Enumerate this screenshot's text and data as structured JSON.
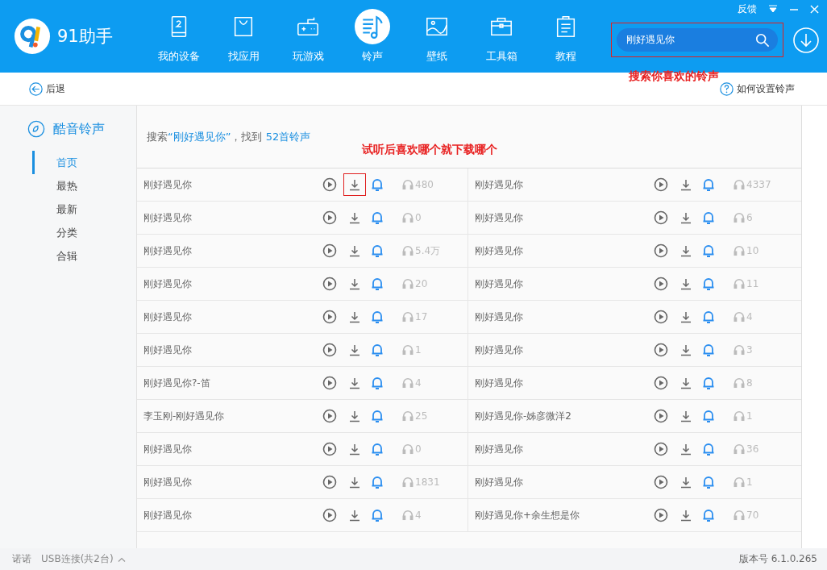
{
  "window": {
    "controls": [
      "反馈"
    ]
  },
  "logo": {
    "title": "91助手"
  },
  "nav": [
    {
      "label": "我的设备",
      "selected": false,
      "kind": "device"
    },
    {
      "label": "找应用",
      "selected": false,
      "kind": "bag"
    },
    {
      "label": "玩游戏",
      "selected": false,
      "kind": "game"
    },
    {
      "label": "铃声",
      "selected": true,
      "kind": "music"
    },
    {
      "label": "壁纸",
      "selected": false,
      "kind": "image"
    },
    {
      "label": "工具箱",
      "selected": false,
      "kind": "toolbox"
    },
    {
      "label": "教程",
      "selected": false,
      "kind": "clipboard"
    }
  ],
  "search": {
    "value": "刚好遇见你",
    "highlighted": true
  },
  "annotations": [
    "搜索你喜欢的铃声",
    "试听后喜欢哪个就下载哪个"
  ],
  "back": "后退",
  "help": "如何设置铃声",
  "sidebar": {
    "title": "酷音铃声",
    "items": [
      {
        "label": "首页",
        "selected": true
      },
      {
        "label": "最热",
        "selected": false
      },
      {
        "label": "最新",
        "selected": false
      },
      {
        "label": "分类",
        "selected": false
      },
      {
        "label": "合辑",
        "selected": false
      }
    ]
  },
  "result": {
    "prefix": "搜索",
    "query": "“刚好遇见你”",
    "middle": "，找到",
    "count": "52首铃声"
  },
  "ringtones": [
    {
      "name": "刚好遇见你",
      "plays": "480",
      "highlighted": true
    },
    {
      "name": "刚好遇见你",
      "plays": "4337",
      "highlighted": false
    },
    {
      "name": "刚好遇见你",
      "plays": "0",
      "highlighted": false
    },
    {
      "name": "刚好遇见你",
      "plays": "6",
      "highlighted": false
    },
    {
      "name": "刚好遇见你",
      "plays": "5.4万",
      "highlighted": false
    },
    {
      "name": "刚好遇见你",
      "plays": "10",
      "highlighted": false
    },
    {
      "name": "刚好遇见你",
      "plays": "20",
      "highlighted": false
    },
    {
      "name": "刚好遇见你",
      "plays": "11",
      "highlighted": false
    },
    {
      "name": "刚好遇见你",
      "plays": "17",
      "highlighted": false
    },
    {
      "name": "刚好遇见你",
      "plays": "4",
      "highlighted": false
    },
    {
      "name": "刚好遇见你",
      "plays": "1",
      "highlighted": false
    },
    {
      "name": "刚好遇见你",
      "plays": "3",
      "highlighted": false
    },
    {
      "name": "刚好遇见你?-笛",
      "plays": "4",
      "highlighted": false
    },
    {
      "name": "刚好遇见你",
      "plays": "8",
      "highlighted": false
    },
    {
      "name": "李玉刚-刚好遇见你",
      "plays": "25",
      "highlighted": false
    },
    {
      "name": "刚好遇见你-姊彦微洋2",
      "plays": "1",
      "highlighted": false
    },
    {
      "name": "刚好遇见你",
      "plays": "0",
      "highlighted": false
    },
    {
      "name": "刚好遇见你",
      "plays": "36",
      "highlighted": false
    },
    {
      "name": "刚好遇见你",
      "plays": "1831",
      "highlighted": false
    },
    {
      "name": "刚好遇见你",
      "plays": "1",
      "highlighted": false
    },
    {
      "name": "刚好遇见你",
      "plays": "4",
      "highlighted": false
    },
    {
      "name": "刚好遇见你+余生想是你",
      "plays": "70",
      "highlighted": false
    }
  ],
  "status_bar": {
    "device": "诺诺",
    "connection": "USB连接(共2台)",
    "version": "版本号 6.1.0.265"
  }
}
